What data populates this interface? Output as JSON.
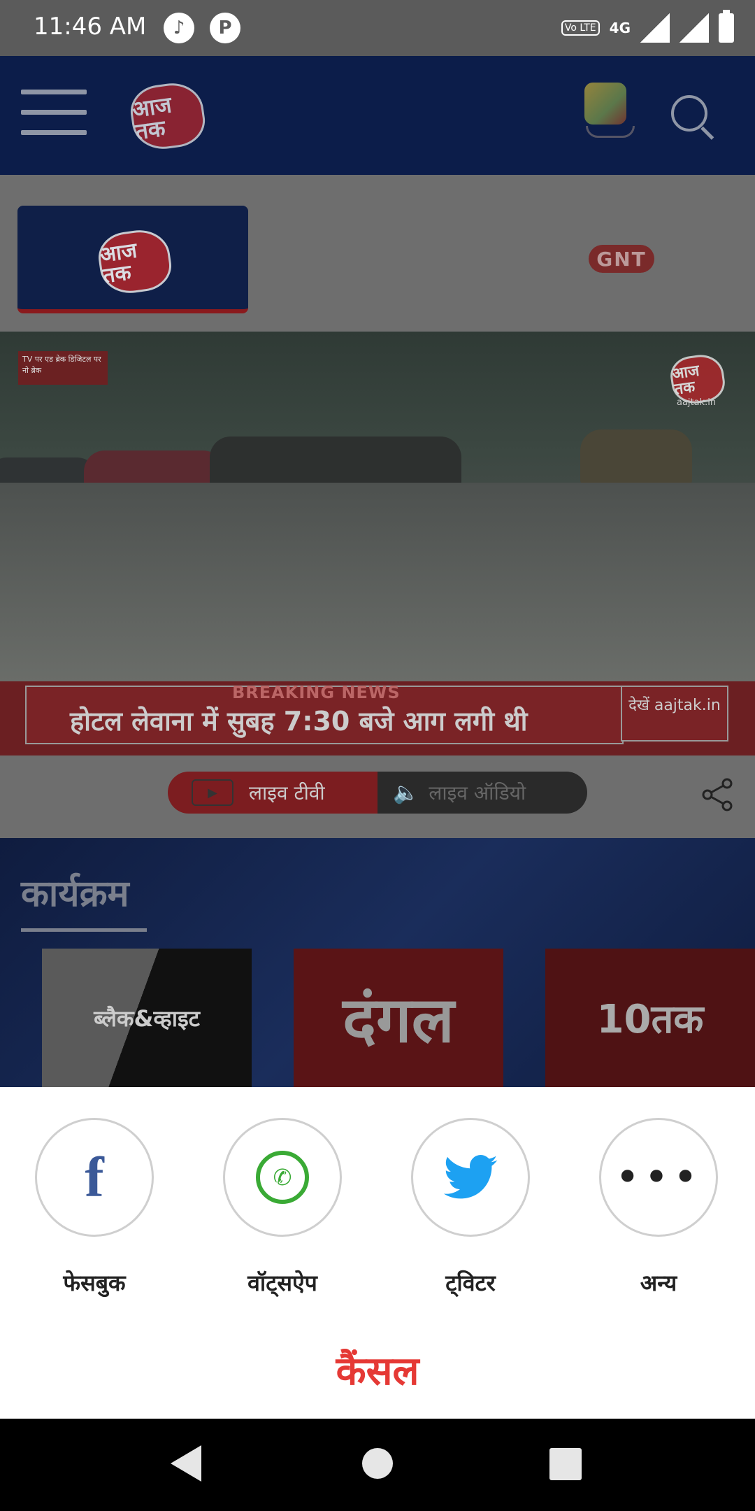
{
  "status_bar": {
    "time": "11:46 AM",
    "network": "4G",
    "volte": "Vo LTE",
    "icons": [
      "music-note-icon",
      "parking-icon",
      "volte-icon",
      "data-arrows-icon",
      "signal-icon",
      "signal-x-icon",
      "battery-charging-icon"
    ]
  },
  "header": {
    "logo_text": "आज तक",
    "icons": [
      "menu-icon",
      "dice-icon",
      "search-icon"
    ]
  },
  "channel_tabs": {
    "active_logo": "आज तक",
    "other": "GNT"
  },
  "video": {
    "corner_badge": "TV पर एड ब्रेक डिजिटल पर नो ब्रेक",
    "watermark_logo": "आज तक",
    "watermark_caption": "aajtak.in"
  },
  "breaking": {
    "label": "BREAKING NEWS",
    "headline": "होटल लेवाना में सुबह 7:30 बजे आग लगी थी",
    "side_text": "देखें aajtak.in"
  },
  "live_toggle": {
    "tv_label": "लाइव टीवी",
    "audio_label": "लाइव ऑडियो"
  },
  "programs": {
    "title": "कार्यक्रम",
    "items": [
      {
        "label": "ब्लैक&व्हाइट"
      },
      {
        "label": "दंगल"
      },
      {
        "label": "10तक"
      }
    ]
  },
  "share_sheet": {
    "options": [
      {
        "label": "फेसबुक",
        "icon": "facebook-icon",
        "color": "#3b5998"
      },
      {
        "label": "वॉट्सऐप",
        "icon": "whatsapp-icon",
        "color": "#3aaa35"
      },
      {
        "label": "ट्विटर",
        "icon": "twitter-icon",
        "color": "#1da1f2"
      },
      {
        "label": "अन्य",
        "icon": "more-icon",
        "color": "#222222"
      }
    ],
    "cancel_label": "कैंसल",
    "cancel_color": "#e53935"
  }
}
